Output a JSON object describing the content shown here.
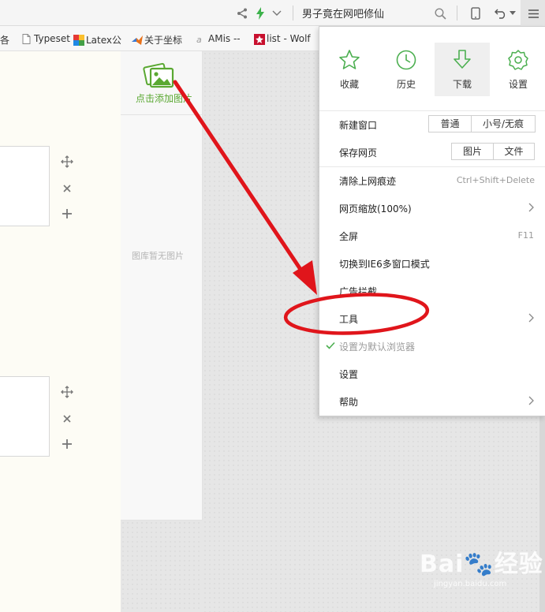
{
  "toolbar": {
    "search_text": "男子竟在网吧修仙"
  },
  "bookmarks": [
    {
      "label": "各",
      "icon": "folder-icon"
    },
    {
      "label": "Typeset",
      "icon": "page-icon"
    },
    {
      "label": "Latex公",
      "icon": "colorful-logo-icon"
    },
    {
      "label": "关于坐标",
      "icon": "matlab-icon"
    },
    {
      "label": "AMis --",
      "icon": "a-logo-icon"
    },
    {
      "label": "list - Wolf",
      "icon": "wolfram-icon"
    }
  ],
  "gallery": {
    "add_label": "点击添加图片",
    "empty_label": "图库暂无图片"
  },
  "menu": {
    "quick": [
      {
        "label": "收藏",
        "icon": "star-icon"
      },
      {
        "label": "历史",
        "icon": "clock-icon"
      },
      {
        "label": "下载",
        "icon": "download-icon"
      },
      {
        "label": "设置",
        "icon": "gear-icon"
      }
    ],
    "new_window": {
      "label": "新建窗口",
      "buttons": [
        "普通",
        "小号/无痕"
      ]
    },
    "save_page": {
      "label": "保存网页",
      "buttons": [
        "图片",
        "文件"
      ]
    },
    "clear_history": {
      "label": "清除上网痕迹",
      "shortcut": "Ctrl+Shift+Delete"
    },
    "zoom": {
      "label": "网页缩放(100%)"
    },
    "fullscreen": {
      "label": "全屏",
      "shortcut": "F11"
    },
    "ie6_mode": {
      "label": "切换到IE6多窗口模式"
    },
    "ad_block": {
      "label": "广告拦截"
    },
    "tools": {
      "label": "工具"
    },
    "default_browser": {
      "label": "设置为默认浏览器"
    },
    "settings": {
      "label": "设置"
    },
    "help": {
      "label": "帮助"
    }
  },
  "watermark": {
    "brand": "Bai",
    "brand2": "经验",
    "sub": "jingyan.baidu.com"
  },
  "colors": {
    "accent_green": "#5aa832",
    "annotation_red": "#e0151b"
  }
}
